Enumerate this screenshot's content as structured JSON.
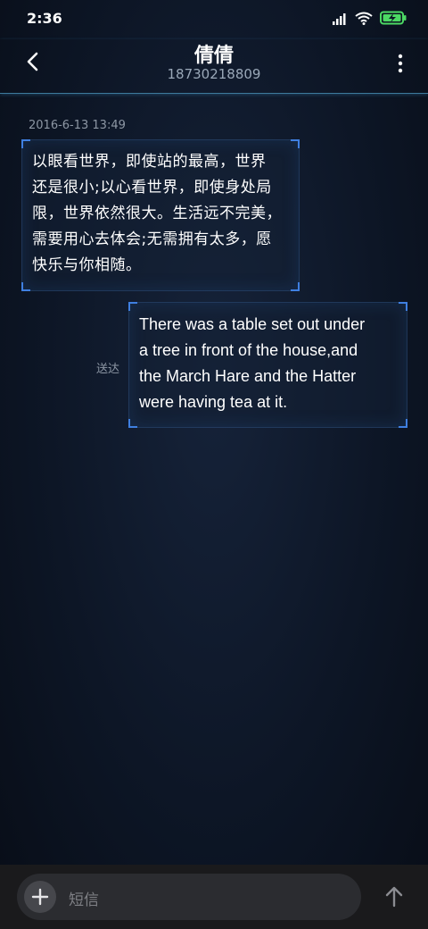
{
  "status_bar": {
    "time": "2:36",
    "icons": [
      "signal-icon",
      "wifi-icon",
      "battery-charging-icon"
    ]
  },
  "header": {
    "contact_name": "倩倩",
    "contact_number": "18730218809",
    "back_icon": "chevron-left-icon",
    "menu_icon": "more-vertical-icon"
  },
  "conversation": {
    "timestamp": "2016-6-13 13:49",
    "incoming": {
      "lines": [
        "以眼看世界，即使站的最高，世界",
        "还是很小;以心看世界，即使身处局",
        "限，世界依然很大。生活远不完美，",
        "需要用心去体会;无需拥有太多，愿",
        "快乐与你相随。"
      ]
    },
    "outgoing": {
      "lines": [
        "There was a table set out under",
        "a tree in front of the house,and",
        "the March Hare and the Hatter",
        "were having tea at it."
      ],
      "status": "送达"
    }
  },
  "composer": {
    "placeholder": "短信",
    "add_icon": "plus-icon",
    "send_icon": "arrow-up-icon"
  },
  "colors": {
    "accent_corner": "#3f7fe0",
    "header_border": "#3d7a9c",
    "background": "#0d1626"
  }
}
